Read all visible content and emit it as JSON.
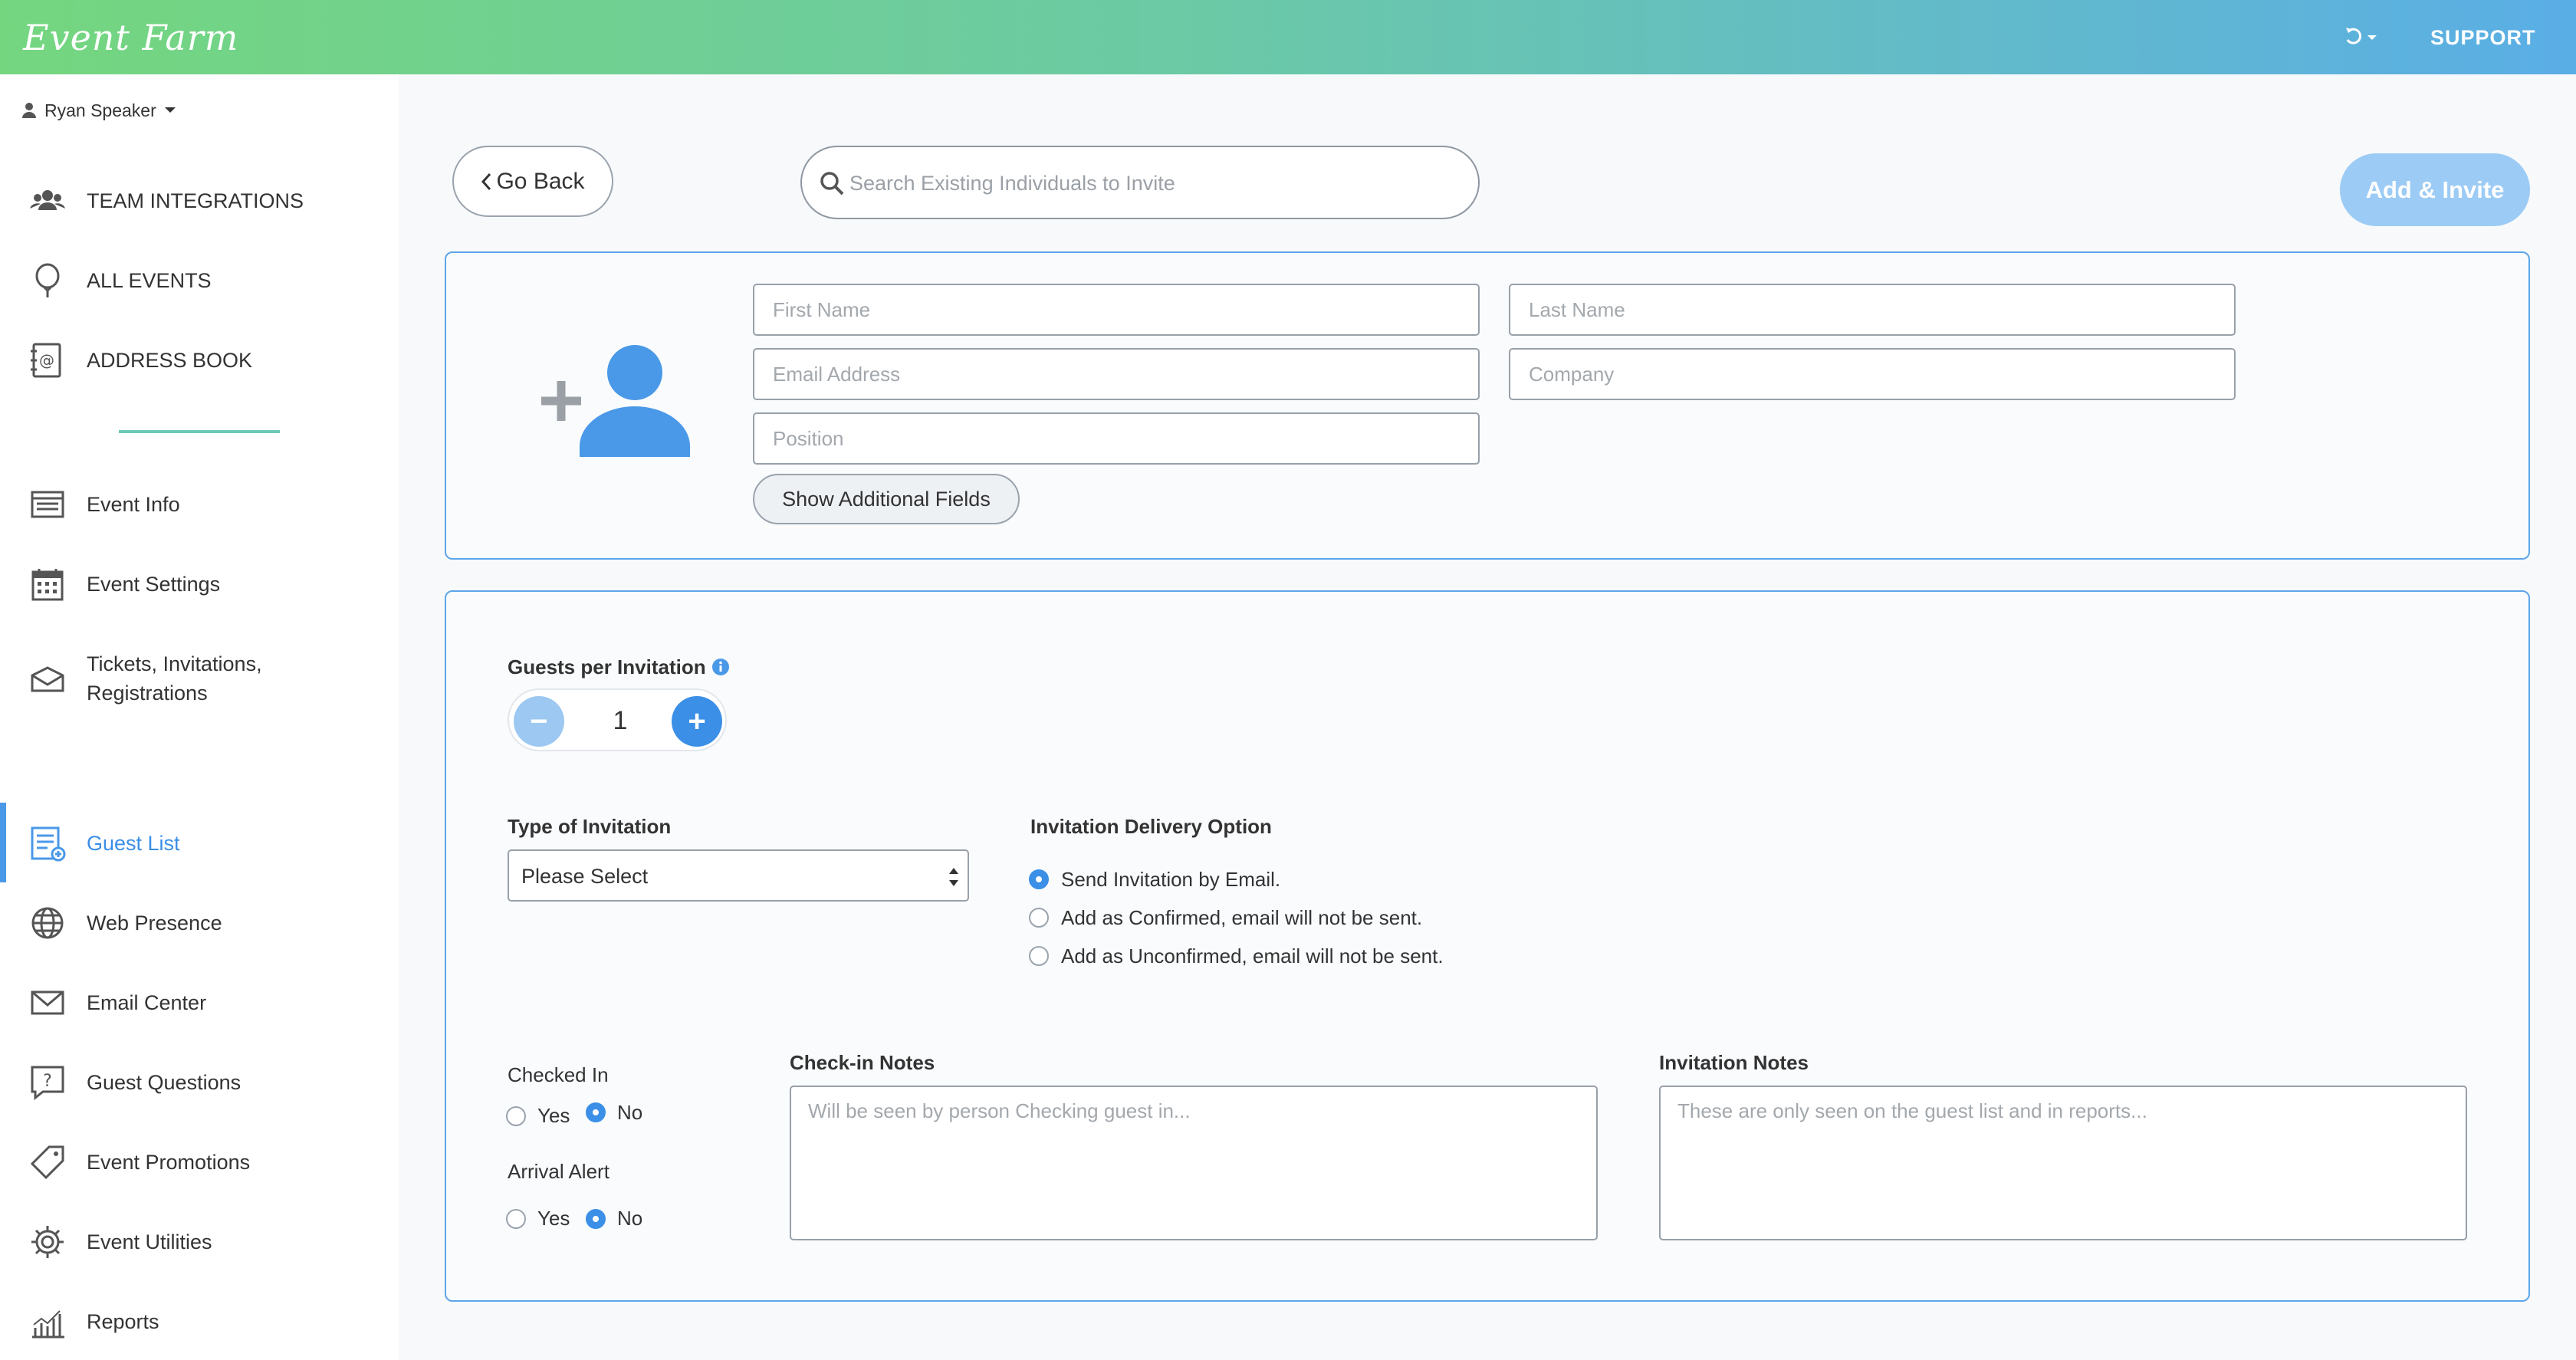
{
  "header": {
    "logo_text": "Event Farm",
    "support_label": "SUPPORT"
  },
  "sidebar": {
    "user_name": "Ryan Speaker",
    "top_items": [
      {
        "label": "TEAM INTEGRATIONS",
        "icon": "team-icon"
      },
      {
        "label": "ALL EVENTS",
        "icon": "balloon-icon"
      },
      {
        "label": "ADDRESS BOOK",
        "icon": "address-book-icon"
      }
    ],
    "event_items": [
      {
        "label": "Event Info",
        "icon": "event-info-icon"
      },
      {
        "label": "Event Settings",
        "icon": "calendar-icon"
      },
      {
        "label": "Tickets, Invitations,",
        "label2": "Registrations",
        "icon": "ticket-icon"
      },
      {
        "label": "Guest List",
        "icon": "guest-list-icon",
        "active": true
      },
      {
        "label": "Web Presence",
        "icon": "globe-icon"
      },
      {
        "label": "Email Center",
        "icon": "envelope-icon"
      },
      {
        "label": "Guest Questions",
        "icon": "question-icon"
      },
      {
        "label": "Event Promotions",
        "icon": "tag-icon"
      },
      {
        "label": "Event Utilities",
        "icon": "gear-icon"
      },
      {
        "label": "Reports",
        "icon": "reports-icon"
      }
    ]
  },
  "toolbar": {
    "back_label": "Go Back",
    "search_placeholder": "Search Existing Individuals to Invite",
    "add_invite_label": "Add & Invite"
  },
  "person_form": {
    "first_name_placeholder": "First Name",
    "last_name_placeholder": "Last Name",
    "email_placeholder": "Email Address",
    "company_placeholder": "Company",
    "position_placeholder": "Position",
    "additional_fields_label": "Show Additional Fields"
  },
  "invite_form": {
    "guests_label": "Guests per Invitation",
    "guests_value": "1",
    "type_label": "Type of Invitation",
    "type_selected": "Please Select",
    "delivery_label": "Invitation Delivery Option",
    "delivery_options": [
      "Send Invitation by Email.",
      "Add as Confirmed, email will not be sent.",
      "Add as Unconfirmed, email will not be sent."
    ],
    "delivery_selected_index": 0,
    "checked_in_label": "Checked In",
    "arrival_alert_label": "Arrival Alert",
    "yes_label": "Yes",
    "no_label": "No",
    "checkin_notes_label": "Check-in Notes",
    "checkin_notes_placeholder": "Will be seen by person Checking guest in...",
    "invitation_notes_label": "Invitation Notes",
    "invitation_notes_placeholder": "These are only seen on the guest list and in reports..."
  },
  "colors": {
    "accent": "#3b8fe6",
    "card_border": "#5ea6ea",
    "add_button": "#9ccbf5",
    "sidebar_separator": "#6cc8b8"
  }
}
